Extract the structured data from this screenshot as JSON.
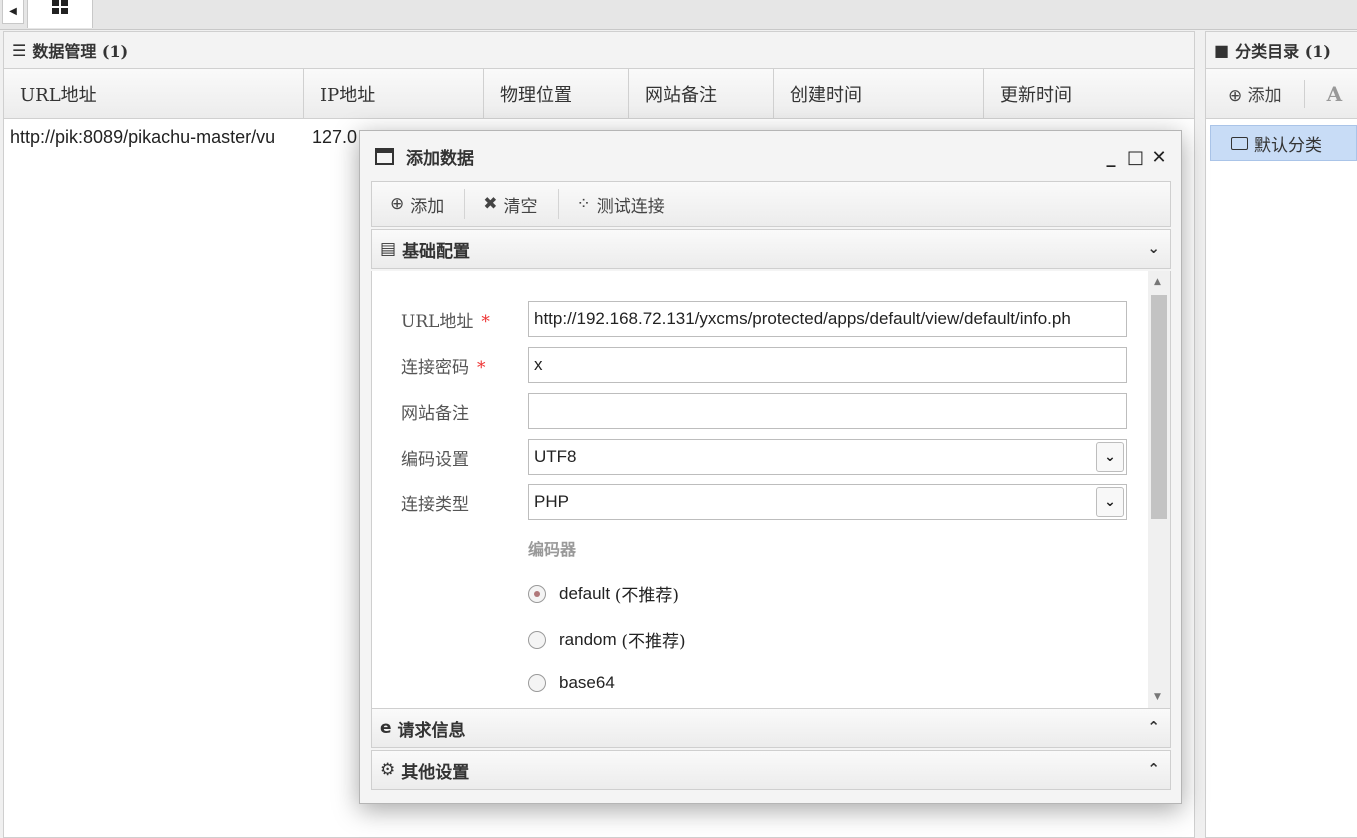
{
  "data_panel": {
    "title": "数据管理 (1)",
    "columns": [
      "URL地址",
      "IP地址",
      "物理位置",
      "网站备注",
      "创建时间",
      "更新时间"
    ],
    "rows": [
      {
        "url": "http://pik:8089/pikachu-master/vu",
        "ip": "127.0"
      }
    ]
  },
  "category_panel": {
    "title": "分类目录 (1)",
    "add_label": "添加",
    "rename_glyph": "A",
    "items": [
      "默认分类"
    ]
  },
  "dialog": {
    "title": "添加数据",
    "toolbar": {
      "add": "添加",
      "clear": "清空",
      "test": "测试连接"
    },
    "sections": {
      "basic": "基础配置",
      "request": "请求信息",
      "other": "其他设置"
    },
    "form": {
      "url_label": "URL地址",
      "url_value": "http://192.168.72.131/yxcms/protected/apps/default/view/default/info.ph",
      "password_label": "连接密码",
      "password_value": "x",
      "note_label": "网站备注",
      "note_value": "",
      "encoding_label": "编码设置",
      "encoding_value": "UTF8",
      "type_label": "连接类型",
      "type_value": "PHP",
      "encoder_title": "编码器",
      "required_mark": "*",
      "encoders": [
        {
          "name": "default",
          "note": "(不推荐)",
          "selected": true
        },
        {
          "name": "random",
          "note": "(不推荐)",
          "selected": false
        },
        {
          "name": "base64",
          "note": "",
          "selected": false
        }
      ]
    }
  },
  "colors": {
    "selected_category": "#c8dcf6",
    "required": "#ee3333"
  }
}
